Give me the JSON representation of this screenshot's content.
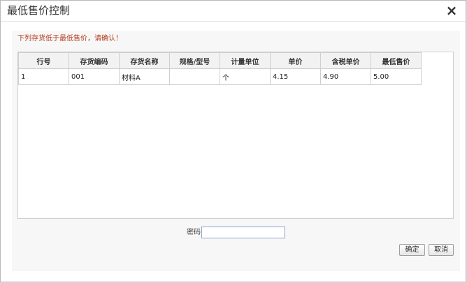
{
  "dialog": {
    "title": "最低售价控制",
    "close_icon": "close-icon",
    "warning": "下列存货低于最低售价，请确认！"
  },
  "table": {
    "headers": [
      "行号",
      "存货编码",
      "存货名称",
      "规格/型号",
      "计量单位",
      "单价",
      "含税单价",
      "最低售价"
    ],
    "rows": [
      [
        "1",
        "001",
        "材料A",
        "",
        "个",
        "4.15",
        "4.90",
        "5.00"
      ]
    ]
  },
  "password": {
    "label": "密码",
    "value": ""
  },
  "buttons": {
    "ok": "确定",
    "cancel": "取消"
  }
}
